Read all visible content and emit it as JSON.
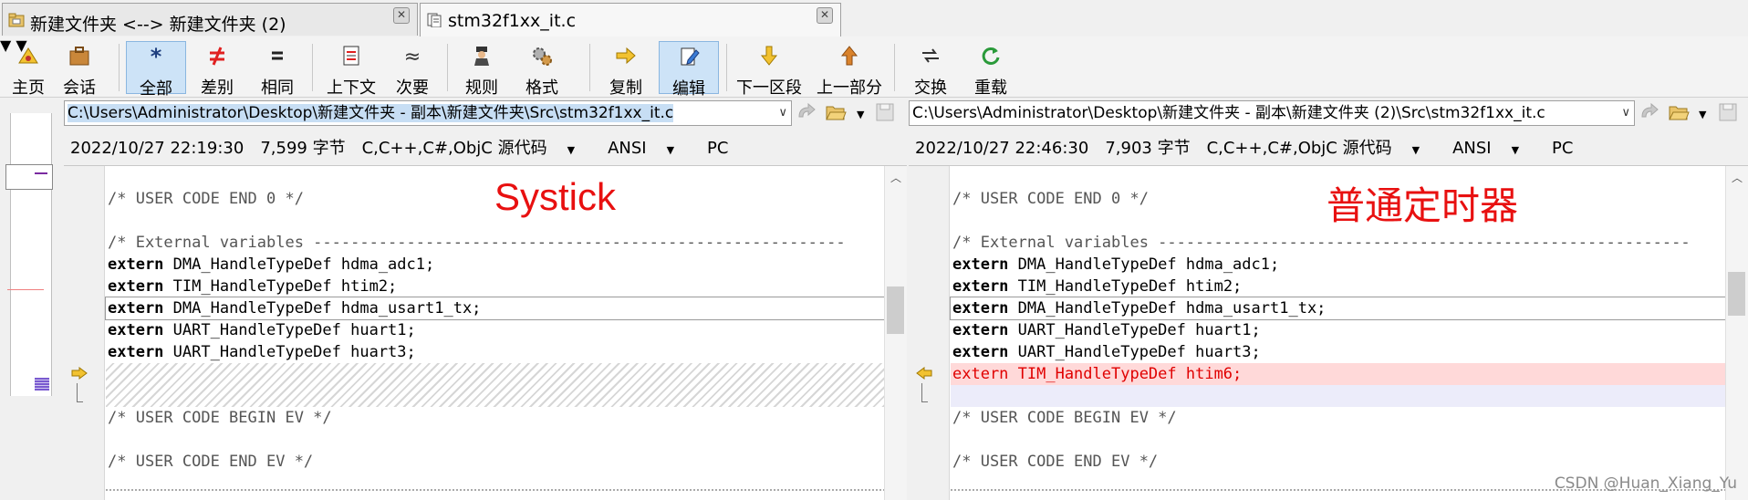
{
  "tabs": [
    {
      "label": "新建文件夹 <--> 新建文件夹 (2)"
    },
    {
      "label": "stm32f1xx_it.c"
    }
  ],
  "toolbar": {
    "home": "主页",
    "session": "会话",
    "all": "全部",
    "diffs": "差别",
    "same": "相同",
    "context": "上下文",
    "minor": "次要",
    "rules": "规则",
    "format": "格式",
    "copy": "复制",
    "edit": "编辑",
    "next_section": "下一区段",
    "prev_section": "上一部分",
    "swap": "交换",
    "reload": "重载"
  },
  "left": {
    "path": "C:\\Users\\Administrator\\Desktop\\新建文件夹 - 副本\\新建文件夹\\Src\\stm32f1xx_it.c",
    "datetime": "2022/10/27 22:19:30",
    "size": "7,599 字节",
    "format": "C,C++,C#,ObjC 源代码",
    "encoding": "ANSI",
    "lineend": "PC",
    "annotation": "Systick"
  },
  "right": {
    "path": "C:\\Users\\Administrator\\Desktop\\新建文件夹 - 副本\\新建文件夹 (2)\\Src\\stm32f1xx_it.c",
    "datetime": "2022/10/27 22:46:30",
    "size": "7,903 字节",
    "format": "C,C++,C#,ObjC 源代码",
    "encoding": "ANSI",
    "lineend": "PC",
    "annotation": "普通定时器"
  },
  "code": {
    "user_code_end_0": "/* USER CODE END 0 */",
    "external_vars": "/* External variables ---------------------------------------------------------",
    "kw_extern": "extern",
    "l1": " DMA_HandleTypeDef hdma_adc1;",
    "l2": " TIM_HandleTypeDef htim2;",
    "l3": " DMA_HandleTypeDef hdma_usart1_tx;",
    "l4": " UART_HandleTypeDef huart1;",
    "l5": " UART_HandleTypeDef huart3;",
    "diff_line": "extern TIM_HandleTypeDef htim6;",
    "user_code_begin_ev": "/* USER CODE BEGIN EV */",
    "user_code_end_ev": "/* USER CODE END EV */"
  },
  "watermark": "CSDN @Huan_Xiang_Yu",
  "colors": {
    "accent": "#cde3f7",
    "diff_red": "#e00000",
    "annotation_red": "#e81010"
  }
}
